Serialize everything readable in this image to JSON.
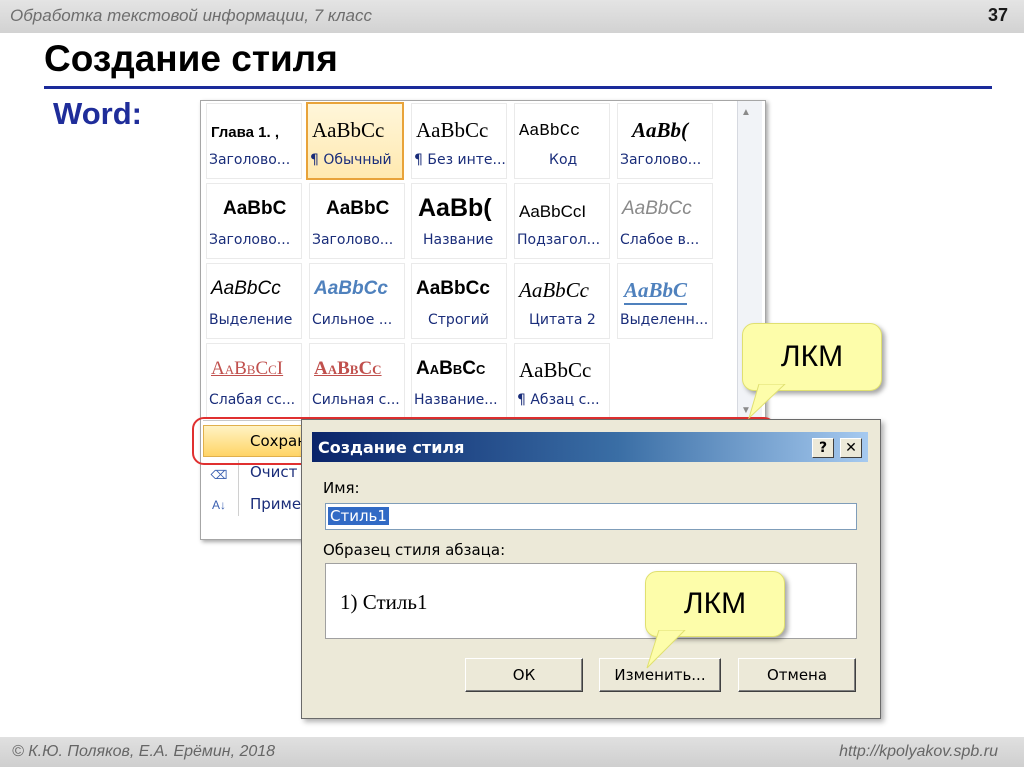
{
  "slide": {
    "topic": "Обработка текстовой информации, 7 класс",
    "page_number": "37",
    "title": "Создание стиля",
    "app_label": "Word:"
  },
  "gallery": {
    "rows": [
      [
        {
          "sample": "Глава 1. ,",
          "label": "Заголово..."
        },
        {
          "sample": "AaBbCc",
          "label": "¶ Обычный"
        },
        {
          "sample": "AaBbCc",
          "label": "¶ Без инте..."
        },
        {
          "sample": "AaBbCc",
          "label": "Код"
        },
        {
          "sample": "AaBb(",
          "label": "Заголово..."
        }
      ],
      [
        {
          "sample": "AaBbC",
          "label": "Заголово..."
        },
        {
          "sample": "AaBbC",
          "label": "Заголово..."
        },
        {
          "sample": "AaBb(",
          "label": "Название"
        },
        {
          "sample": "AaBbCcI",
          "label": "Подзагол..."
        },
        {
          "sample": "AaBbCc",
          "label": "Слабое в..."
        }
      ],
      [
        {
          "sample": "AaBbCc",
          "label": "Выделение"
        },
        {
          "sample": "AaBbCc",
          "label": "Сильное ..."
        },
        {
          "sample": "AaBbCc",
          "label": "Строгий"
        },
        {
          "sample": "AaBbCc",
          "label": "Цитата 2"
        },
        {
          "sample": "AaBbC",
          "label": "Выделенн..."
        }
      ],
      [
        {
          "sample": "AaBbCcI",
          "label": "Слабая сс..."
        },
        {
          "sample": "AaBbCc",
          "label": "Сильная с..."
        },
        {
          "sample": "AaBbCc",
          "label": "Название..."
        },
        {
          "sample": "AaBbCc",
          "label": "¶ Абзац с..."
        }
      ]
    ],
    "selected": "¶ Обычный",
    "commands": {
      "save": "Сохран",
      "clear": "Очист",
      "apply": "Приме"
    }
  },
  "dialog": {
    "title": "Создание стиля",
    "help_button": "?",
    "close_button": "✕",
    "name_label": "Имя:",
    "name_value": "Стиль1",
    "preview_label": "Образец стиля абзаца:",
    "preview_text": "1)  Стиль1",
    "ok_label": "ОК",
    "modify_label": "Изменить...",
    "cancel_label": "Отмена"
  },
  "callouts": {
    "top": "ЛКМ",
    "bottom": "ЛКМ"
  },
  "footer": {
    "authors": "© К.Ю. Поляков, Е.А. Ерёмин, 2018",
    "url": "http://kpolyakov.spb.ru"
  },
  "colors": {
    "title_rule": "#1a2a9a",
    "word_label": "#1f2d9a",
    "callout_bg": "#fdfdaa",
    "selection": "#316ac5",
    "highlight_oval": "#e03030"
  },
  "icons": {
    "scroll_up": "triangle-up-icon",
    "scroll_down": "triangle-down-icon",
    "clear": "eraser-icon",
    "apply": "apply-styles-icon"
  }
}
